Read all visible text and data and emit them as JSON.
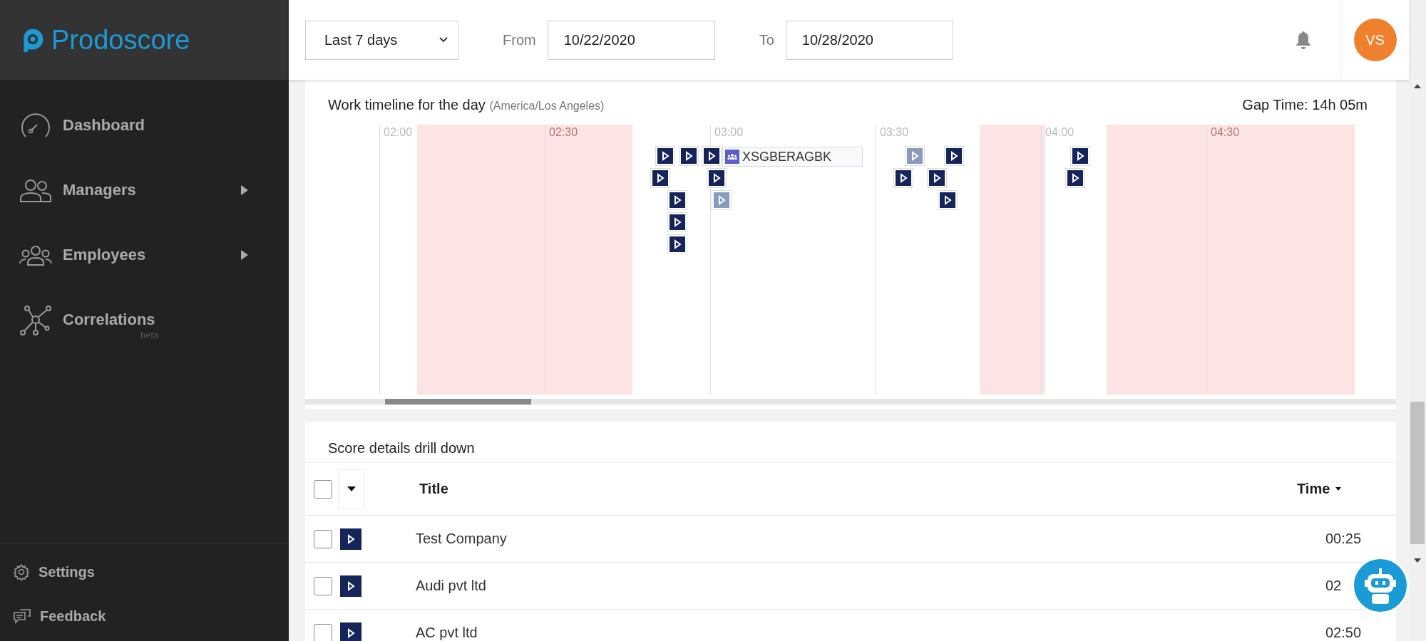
{
  "sidebar": {
    "logo": "Prodoscore",
    "items": [
      {
        "label": "Dashboard",
        "has_submenu": false
      },
      {
        "label": "Managers",
        "has_submenu": true
      },
      {
        "label": "Employees",
        "has_submenu": true
      },
      {
        "label": "Correlations",
        "badge": "beta",
        "has_submenu": false
      }
    ],
    "footer_items": [
      {
        "label": "Settings"
      },
      {
        "label": "Feedback"
      }
    ]
  },
  "header": {
    "range_select": "Last 7 days",
    "from_label": "From",
    "from_value": "10/22/2020",
    "to_label": "To",
    "to_value": "10/28/2020",
    "avatar": "VS"
  },
  "timeline": {
    "title": "Work timeline for the day",
    "timezone": "(America/Los Angeles)",
    "gap_time": "Gap Time: 14h 05m",
    "ticks": [
      "02:00",
      "02:30",
      "03:00",
      "03:30",
      "04:00",
      "04:30"
    ],
    "events": [
      {
        "kind": "app",
        "dimmed": false
      },
      {
        "kind": "app",
        "dimmed": false
      },
      {
        "kind": "app",
        "dimmed": false
      },
      {
        "kind": "meeting",
        "label": "XSGBERAGBK"
      },
      {
        "kind": "app",
        "dimmed": true
      },
      {
        "kind": "app",
        "dimmed": false
      },
      {
        "kind": "app",
        "dimmed": false
      },
      {
        "kind": "app",
        "dimmed": false
      },
      {
        "kind": "app",
        "dimmed": false
      },
      {
        "kind": "app",
        "dimmed": false
      },
      {
        "kind": "app",
        "dimmed": false
      },
      {
        "kind": "app",
        "dimmed": false
      },
      {
        "kind": "app",
        "dimmed": false
      },
      {
        "kind": "app",
        "dimmed": true
      },
      {
        "kind": "app",
        "dimmed": false
      },
      {
        "kind": "app",
        "dimmed": false
      },
      {
        "kind": "app",
        "dimmed": false
      }
    ]
  },
  "score_details": {
    "title": "Score details drill down",
    "select_all_checked": false,
    "columns": [
      "Title",
      "Time"
    ],
    "rows": [
      {
        "title": "Test Company",
        "time": "00:25",
        "checked": false
      },
      {
        "title": "Audi pvt ltd",
        "time": "02",
        "checked": false
      },
      {
        "title": "AC pvt ltd",
        "time": "02:50",
        "checked": false
      }
    ]
  }
}
